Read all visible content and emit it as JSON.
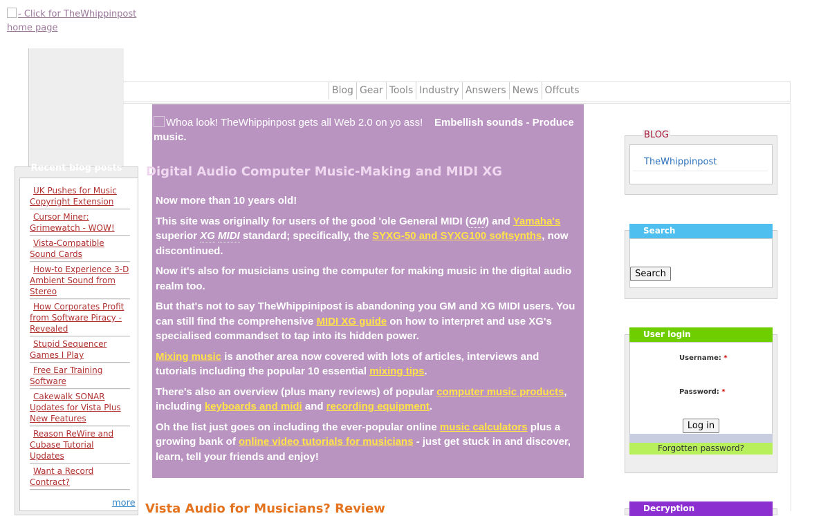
{
  "logo": {
    "alt_text": "- Click for TheWhippinpost home page"
  },
  "nav": {
    "items": [
      "Blog",
      "Gear",
      "Tools",
      "Industry",
      "Answers",
      "News",
      "Offcuts"
    ]
  },
  "left_sidebar": {
    "title": "Recent blog posts",
    "posts": [
      "UK Pushes for Music Copyright Extension",
      "Cursor Miner: Grimewatch - WOW!",
      "Vista-Compatible Sound Cards",
      "How-to Experience 3-D Ambient Sound from Stereo",
      "How Corporates Profit from Software Piracy - Revealed",
      "Stupid Sequencer Games I Play",
      "Free Ear Training Software",
      "Cakewalk SONAR Updates for Vista Plus New Features",
      "Reason ReWire and Cubase Tutorial Updates",
      "Want a Record Contract?"
    ],
    "more_label": "more"
  },
  "main": {
    "image_alt": "Whoa look! TheWhippinpost gets all Web 2.0 on yo ass!",
    "tagline": "Embellish sounds - Produce music.",
    "title": "Digital Audio Computer Music-Making and MIDI XG",
    "p1": "Now more than 10 years old!",
    "p2": {
      "a": "This site was originally for users of the good 'ole General MIDI (",
      "gm": "GM",
      "b": ") and ",
      "yamaha": "Yamaha's",
      "c": " superior ",
      "xg": "XG",
      "d": " ",
      "midi": "MIDI",
      "e": " standard; specifically, the ",
      "syxg": "SYXG-50 and SYXG100 softsynths",
      "f": ", now discontinued."
    },
    "p3": "Now it's also for musicians using the computer for making music in the digital audio realm too.",
    "p4": {
      "a": "But that's not to say TheWhippinipost is abandoning you GM and XG MIDI users. You can still find the comprehensive ",
      "guide": "MIDI XG guide",
      "b": " on how to interpret and use XG's specialised commandset to tap into its hidden power."
    },
    "p5": {
      "mixing": "Mixing music",
      "a": " is another area now covered with lots of articles, interviews and tutorials including the popular 10 essential ",
      "tips": "mixing tips",
      "b": "."
    },
    "p6": {
      "a": "There's also an overview (plus many reviews) of popular ",
      "products": "computer music products",
      "b": ", including ",
      "keyboards": "keyboards and midi",
      "c": " and ",
      "recording": "recording equipment",
      "d": "."
    },
    "p7": {
      "a": "Oh the list just goes on including the ever-popular online ",
      "calc": "music calculators",
      "b": " plus a growing bank of ",
      "video": "online video tutorials for musicians",
      "c": " - just get stuck in and discover, learn, tell your friends and enjoy!"
    },
    "next_heading": "Vista Audio for Musicians? Review"
  },
  "right_sidebar": {
    "blog": {
      "title": "BLOG",
      "link": "TheWhippinpost"
    },
    "search": {
      "title": "Search",
      "button": "Search"
    },
    "login": {
      "title": "User login",
      "username_label": "Username:",
      "password_label": "Password:",
      "required_mark": "*",
      "button": "Log in",
      "forgot": "Forgotten password?"
    },
    "decryption": {
      "title": "Decryption"
    }
  },
  "colors": {
    "main_bg": "#b994c0",
    "link_yellow": "#ffe24a",
    "search_header": "#4fbfef",
    "login_header": "#6fce00",
    "decryption_header": "#8c2fd0",
    "heading_orange": "#e4731f"
  }
}
